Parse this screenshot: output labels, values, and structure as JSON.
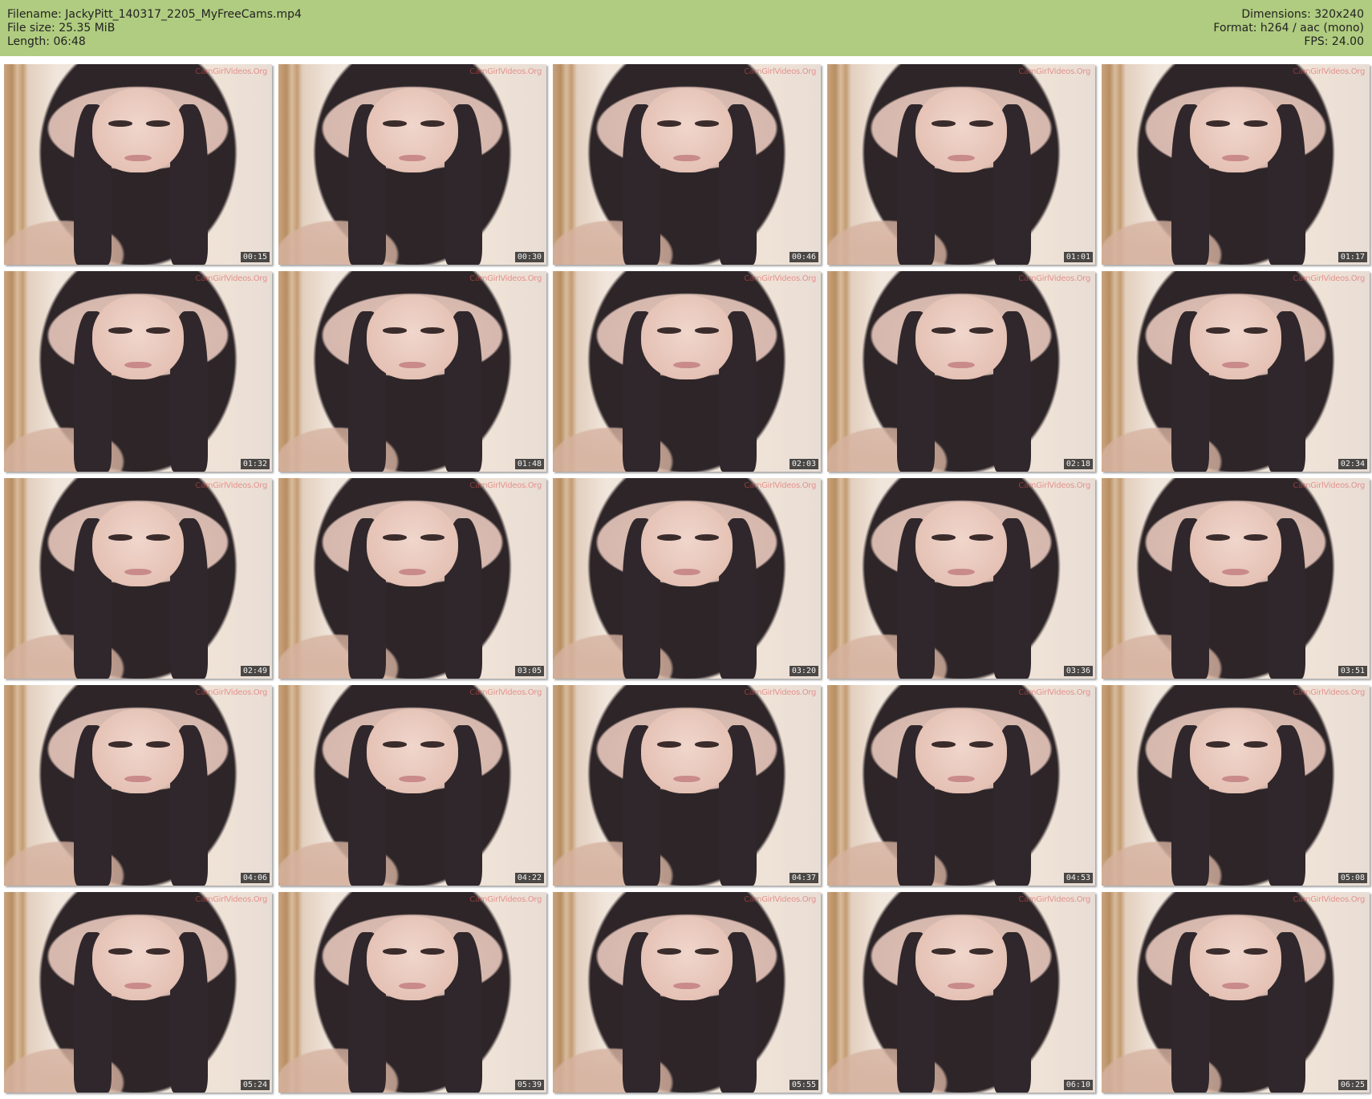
{
  "header": {
    "filename": "Filename: JackyPitt_140317_2205_MyFreeCams.mp4",
    "filesize": "File size: 25.35 MiB",
    "length": "Length: 06:48",
    "dimensions": "Dimensions: 320x240",
    "format": "Format: h264 / aac (mono)",
    "fps": "FPS: 24.00"
  },
  "watermark": "CamGirlVideos.Org",
  "timestamps": [
    "00:15",
    "00:30",
    "00:46",
    "01:01",
    "01:17",
    "01:32",
    "01:48",
    "02:03",
    "02:18",
    "02:34",
    "02:49",
    "03:05",
    "03:20",
    "03:36",
    "03:51",
    "04:06",
    "04:22",
    "04:37",
    "04:53",
    "05:08",
    "05:24",
    "05:39",
    "05:55",
    "06:10",
    "06:25"
  ]
}
